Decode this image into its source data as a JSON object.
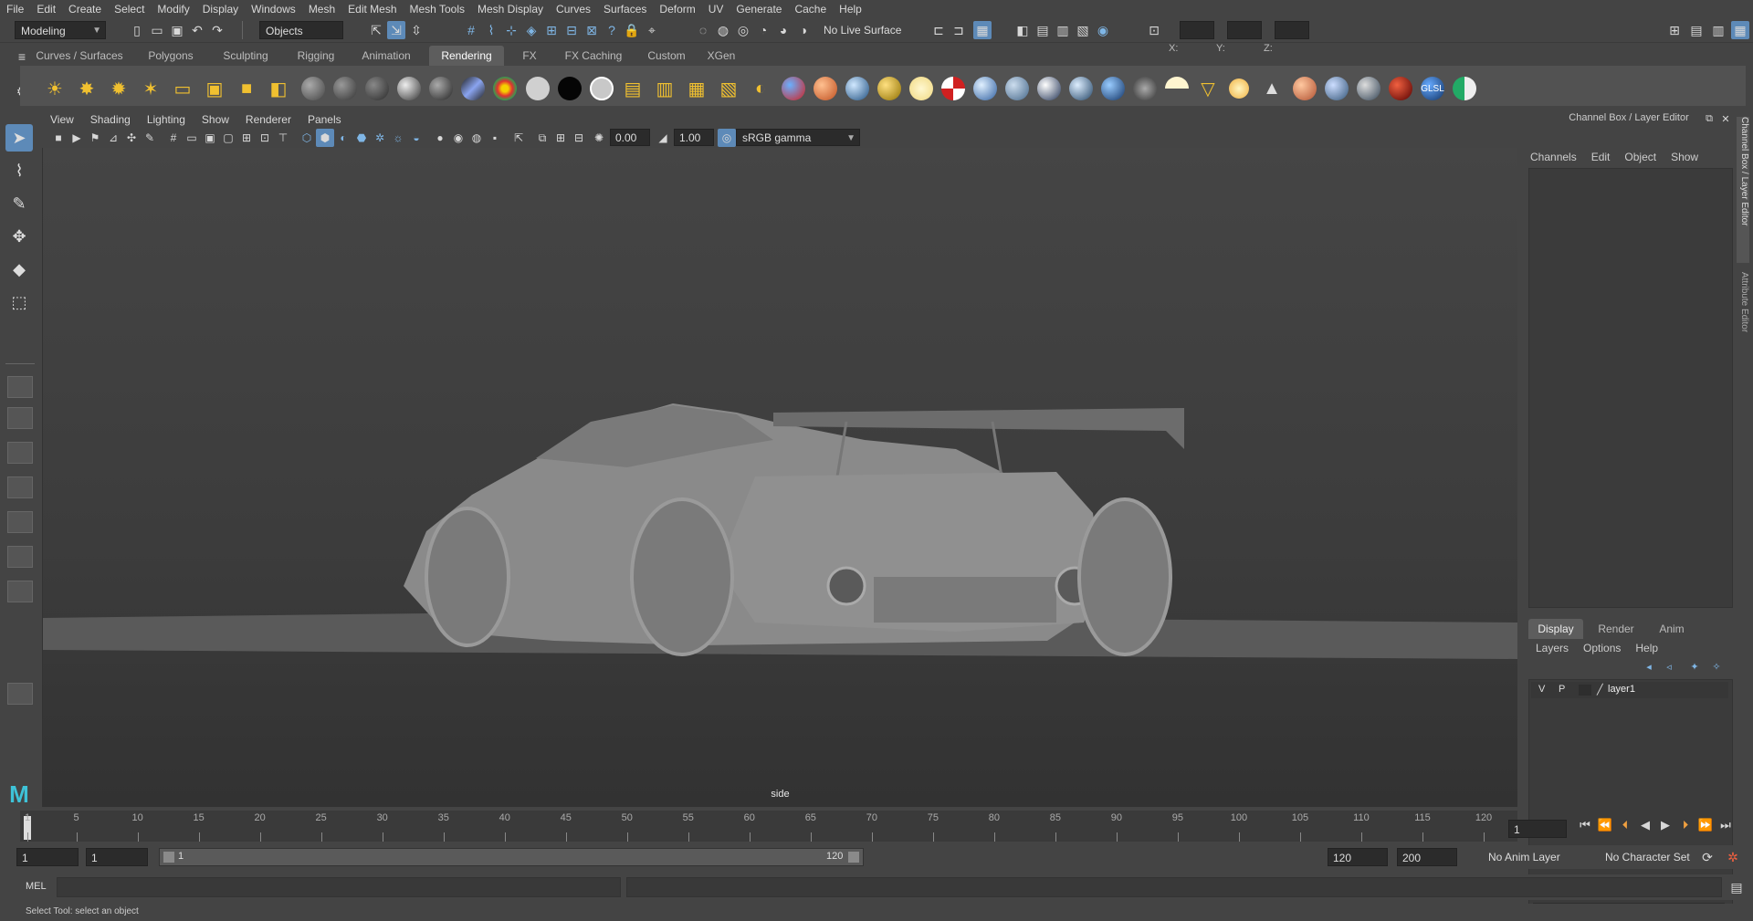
{
  "menubar": [
    "File",
    "Edit",
    "Create",
    "Select",
    "Modify",
    "Display",
    "Windows",
    "Mesh",
    "Edit Mesh",
    "Mesh Tools",
    "Mesh Display",
    "Curves",
    "Surfaces",
    "Deform",
    "UV",
    "Generate",
    "Cache",
    "Help"
  ],
  "statusline": {
    "menuset": "Modeling",
    "selection_mode": "Objects",
    "live_surface": "No Live Surface",
    "coord_x": "X:",
    "coord_y": "Y:",
    "coord_z": "Z:"
  },
  "shelf_tabs": [
    "Curves / Surfaces",
    "Polygons",
    "Sculpting",
    "Rigging",
    "Animation",
    "Rendering",
    "FX",
    "FX Caching",
    "Custom",
    "XGen"
  ],
  "shelf_active_tab": "Rendering",
  "shelf_glsl_label": "GLSL",
  "panel_menu": [
    "View",
    "Shading",
    "Lighting",
    "Show",
    "Renderer",
    "Panels"
  ],
  "panel_toolbar": {
    "exposure": "0.00",
    "gamma": "1.00",
    "color_space": "sRGB gamma"
  },
  "viewport": {
    "camera_label": "side"
  },
  "channel_box": {
    "title": "Channel Box / Layer Editor",
    "menu": [
      "Channels",
      "Edit",
      "Object",
      "Show"
    ],
    "tabs": [
      "Display",
      "Render",
      "Anim"
    ],
    "layer_menu": [
      "Layers",
      "Options",
      "Help"
    ],
    "layer": {
      "v": "V",
      "p": "P",
      "name": "layer1"
    },
    "side_tab_1": "Channel Box / Layer Editor",
    "side_tab_2": "Attribute Editor"
  },
  "timeline": {
    "ticks": [
      "1",
      "5",
      "10",
      "15",
      "20",
      "25",
      "30",
      "35",
      "40",
      "45",
      "50",
      "55",
      "60",
      "65",
      "70",
      "75",
      "80",
      "85",
      "90",
      "95",
      "100",
      "105",
      "110",
      "115",
      "120"
    ],
    "current_frame": "1"
  },
  "range": {
    "start": "1",
    "playback_start": "1",
    "slider_start": "1",
    "slider_end": "120",
    "playback_end": "120",
    "end": "200",
    "anim_layer": "No Anim Layer",
    "character_set": "No Character Set"
  },
  "command_line": {
    "label": "MEL"
  },
  "help_line": "Select Tool: select an object",
  "colors": {
    "accent": "#5d8ab8",
    "background": "#444444",
    "viewport": "#3e3e3e"
  }
}
